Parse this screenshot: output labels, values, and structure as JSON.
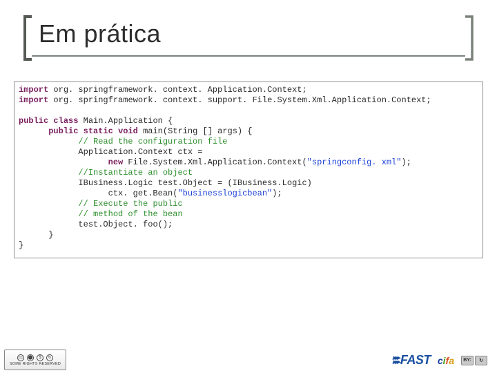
{
  "title": "Em prática",
  "code": {
    "line1_kw": "import",
    "line1_rest": " org. springframework. context. Application.Context;",
    "line2_kw": "import",
    "line2_rest": " org. springframework. context. support. File.System.Xml.Application.Context;",
    "line3_kw1": "public",
    "line3_kw2": "class",
    "line3_rest": " Main.Application {",
    "line4_pad": "      ",
    "line4_kw1": "public",
    "line4_kw2": "static",
    "line4_kw3": "void",
    "line4_rest": " main(String [] args) {",
    "line5_pad": "            ",
    "line5_cmt": "// Read the configuration file",
    "line6_pad": "            ",
    "line6_txt": "Application.Context ctx =",
    "line7_pad": "                  ",
    "line7_kw": "new",
    "line7_mid": " File.System.Xml.Application.Context(",
    "line7_str": "\"springconfig. xml\"",
    "line7_end": ");",
    "line8_pad": "            ",
    "line8_cmt": "//Instantiate an object",
    "line9_pad": "            ",
    "line9_txt": "IBusiness.Logic test.Object = (IBusiness.Logic)",
    "line10_pad": "                  ",
    "line10_mid": "ctx. get.Bean(",
    "line10_str": "\"businesslogicbean\"",
    "line10_end": ");",
    "line11_pad": "            ",
    "line11_cmt": "// Execute the public",
    "line12_pad": "            ",
    "line12_cmt": "// method of the bean",
    "line13_pad": "            ",
    "line13_txt": "test.Object. foo();",
    "line14_pad": "      ",
    "line14_txt": "}",
    "line15_txt": "}"
  },
  "footer": {
    "cc_text": "SOME RIGHTS RESERVED",
    "fast": "FAST",
    "cita_c": "c",
    "cita_i": "i",
    "cita_f": "f",
    "cita_a": "a",
    "by": "BY:",
    "cc_sym": "cc"
  }
}
